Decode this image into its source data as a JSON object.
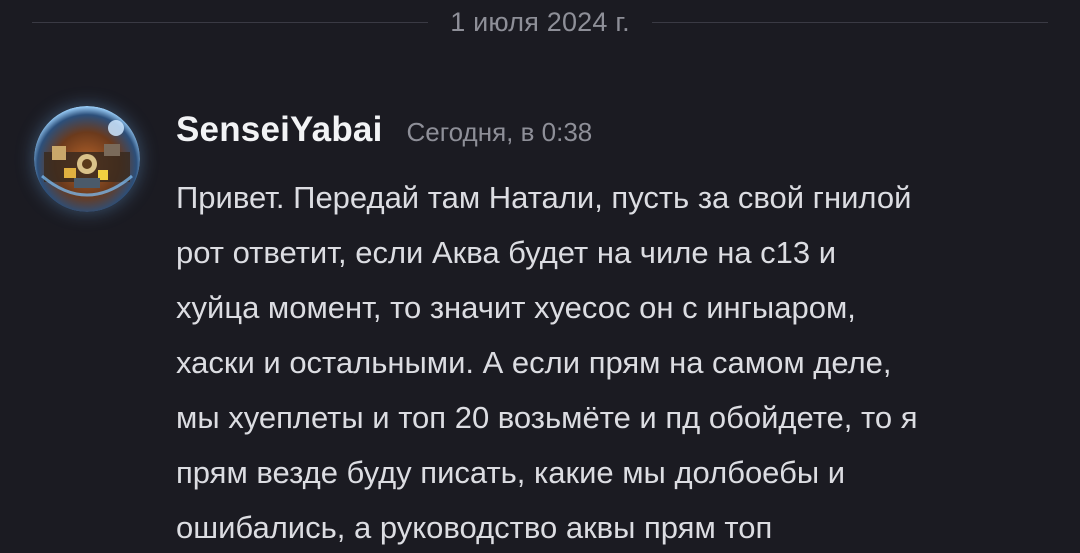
{
  "divider": {
    "date": "1 июля 2024 г."
  },
  "message": {
    "avatar_icon": "round-game-avatar-icon",
    "username": "SenseiYabai",
    "timestamp": "Сегодня, в 0:38",
    "lines": [
      "Привет. Передай там Натали, пусть за свой гнилой",
      "рот ответит, если Аква будет на чиле на с13 и",
      "хуйца момент, то значит хуесос он с ингыаром,",
      "хаски и остальными. А если прям на самом деле,",
      "мы хуеплеты и топ 20 возьмёте и пд обойдете, то я",
      "прям везде буду писать, какие мы долбоебы и",
      "ошибались, а руководство аквы прям топ"
    ]
  },
  "colors": {
    "background": "#1b1b22",
    "username": "#f2f3f5",
    "text": "#dcdde2",
    "muted": "#8e8f98"
  }
}
